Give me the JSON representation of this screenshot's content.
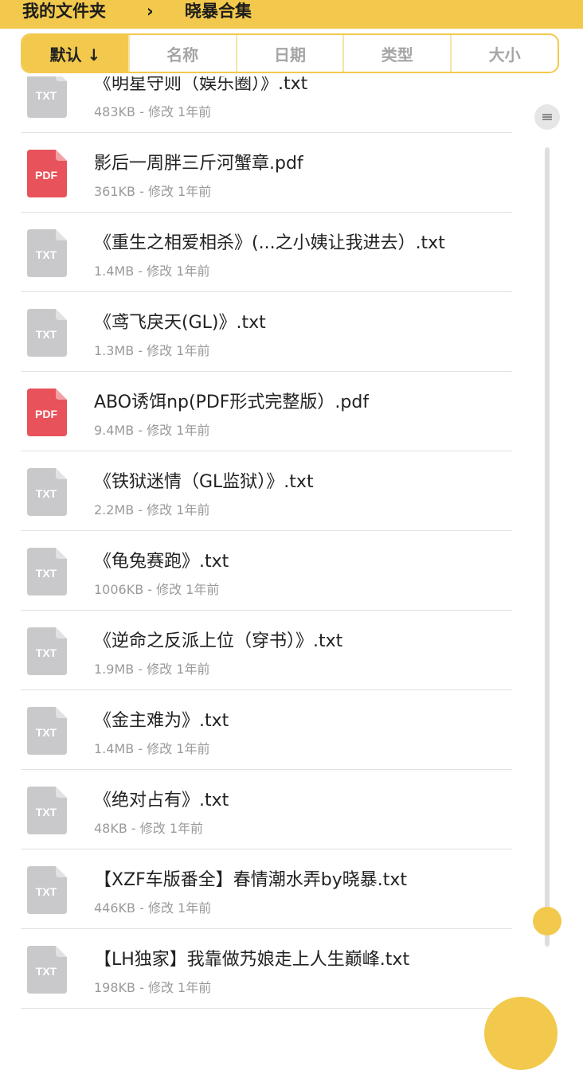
{
  "breadcrumb": {
    "root": "我的文件夹",
    "separator": "›",
    "current": "晓暴合集"
  },
  "sort_tabs": [
    {
      "label": "默认 ↓",
      "active": true
    },
    {
      "label": "名称",
      "active": false
    },
    {
      "label": "日期",
      "active": false
    },
    {
      "label": "类型",
      "active": false
    },
    {
      "label": "大小",
      "active": false
    }
  ],
  "files": [
    {
      "name": "《明星守则（娱乐圈）》.txt",
      "meta": "483KB - 修改 1年前",
      "type": "TXT"
    },
    {
      "name": "影后一周胖三斤河蟹章.pdf",
      "meta": "361KB - 修改 1年前",
      "type": "PDF"
    },
    {
      "name": "《重生之相爱相杀》(...之小姨让我进去）.txt",
      "meta": "1.4MB - 修改 1年前",
      "type": "TXT"
    },
    {
      "name": "《鸢飞戾天(GL)》.txt",
      "meta": "1.3MB - 修改 1年前",
      "type": "TXT"
    },
    {
      "name": "ABO诱饵np(PDF形式完整版）.pdf",
      "meta": "9.4MB - 修改 1年前",
      "type": "PDF"
    },
    {
      "name": "《铁狱迷情（GL监狱）》.txt",
      "meta": "2.2MB - 修改 1年前",
      "type": "TXT"
    },
    {
      "name": "《龟兔赛跑》.txt",
      "meta": "1006KB - 修改 1年前",
      "type": "TXT"
    },
    {
      "name": "《逆命之反派上位（穿书）》.txt",
      "meta": "1.9MB - 修改 1年前",
      "type": "TXT"
    },
    {
      "name": "《金主难为》.txt",
      "meta": "1.4MB - 修改 1年前",
      "type": "TXT"
    },
    {
      "name": "《绝对占有》.txt",
      "meta": "48KB - 修改 1年前",
      "type": "TXT"
    },
    {
      "name": "【XZF车版番全】春情潮水弄by晓暴.txt",
      "meta": "446KB - 修改 1年前",
      "type": "TXT"
    },
    {
      "name": "【LH独家】我靠做艿娘走上人生巅峰.txt",
      "meta": "198KB - 修改 1年前",
      "type": "TXT"
    }
  ],
  "colors": {
    "accent": "#f2c94c",
    "pdf": "#e8525a",
    "txt": "#c9c9cb"
  }
}
